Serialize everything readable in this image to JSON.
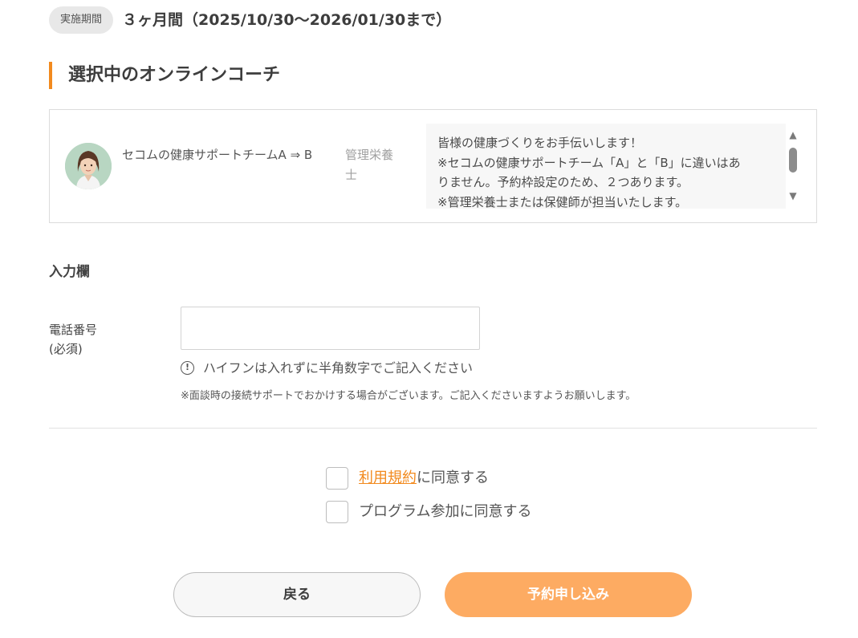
{
  "period": {
    "badge": "実施期間",
    "text": "３ヶ月間（2025/10/30～2026/01/30まで）"
  },
  "coach_section": {
    "title": "選択中のオンラインコーチ"
  },
  "coach": {
    "name": "セコムの健康サポートチームA ⇒ B",
    "role": "管理栄養士",
    "description": [
      "皆様の健康づくりをお手伝いします！",
      "※セコムの健康サポートチーム「A」と「B」に違いはあ",
      "りません。予約枠設定のため、２つあります。",
      "※管理栄養士または保健師が担当いたします。"
    ]
  },
  "icons": {
    "avatar": "coach-avatar-icon",
    "scroll_up": "triangle-up-icon",
    "scroll_down": "triangle-down-icon",
    "hint": "exclamation-circle-icon"
  },
  "input_section": {
    "heading": "入力欄",
    "phone_label_line1": "電話番号",
    "phone_label_line2": "(必須)",
    "phone_value": "",
    "hint": "ハイフンは入れずに半角数字でご記入ください",
    "note": "※面談時の接続サポートでおかけする場合がございます。ご記入くださいますようお願いします。"
  },
  "agreements": {
    "terms_link": "利用規約",
    "terms_suffix": "に同意する",
    "program": "プログラム参加に同意する"
  },
  "buttons": {
    "back": "戻る",
    "submit": "予約申し込み"
  },
  "colors": {
    "accent": "#f28a1e",
    "submit_button": "#fdab62",
    "back_button": "#f7f7f7"
  }
}
